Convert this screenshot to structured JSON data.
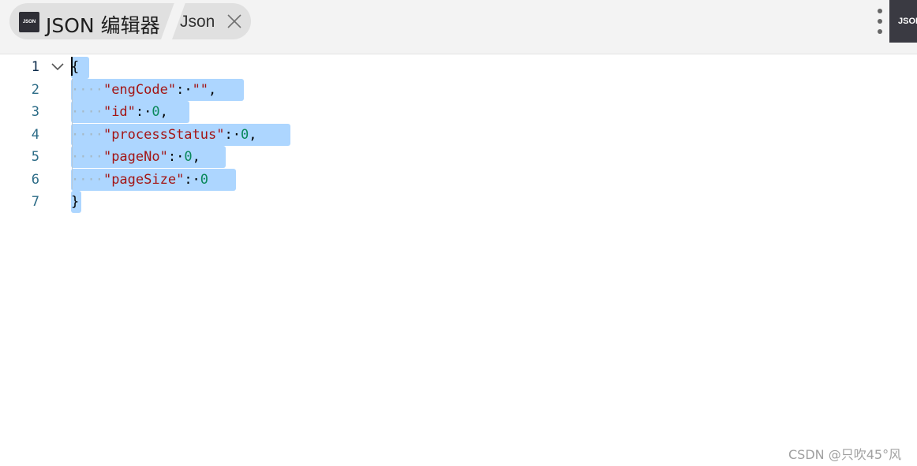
{
  "header": {
    "logo_text": "JSON",
    "app_title": "JSON 编辑器",
    "doc_tab_title": "Json",
    "corner_logo_text": "JSON"
  },
  "editor": {
    "line_numbers": [
      "1",
      "2",
      "3",
      "4",
      "5",
      "6",
      "7"
    ],
    "lines": [
      {
        "ws": "",
        "key": "",
        "sep": "",
        "value": "",
        "punc": "{"
      },
      {
        "ws": "····",
        "key": "\"engCode\"",
        "sep": ":·",
        "value": "\"\"",
        "punc": ","
      },
      {
        "ws": "····",
        "key": "\"id\"",
        "sep": ":·",
        "value": "0",
        "punc": ","
      },
      {
        "ws": "····",
        "key": "\"processStatus\"",
        "sep": ":·",
        "value": "0",
        "punc": ","
      },
      {
        "ws": "····",
        "key": "\"pageNo\"",
        "sep": ":·",
        "value": "0",
        "punc": ","
      },
      {
        "ws": "····",
        "key": "\"pageSize\"",
        "sep": ":·",
        "value": "0",
        "punc": ""
      },
      {
        "ws": "",
        "key": "",
        "sep": "",
        "value": "",
        "punc": "}"
      }
    ]
  },
  "watermark": "CSDN @只吹45°风",
  "colors": {
    "selection": "#add6ff",
    "key": "#a31515",
    "number": "#09885a",
    "line_number": "#2b6b86"
  }
}
